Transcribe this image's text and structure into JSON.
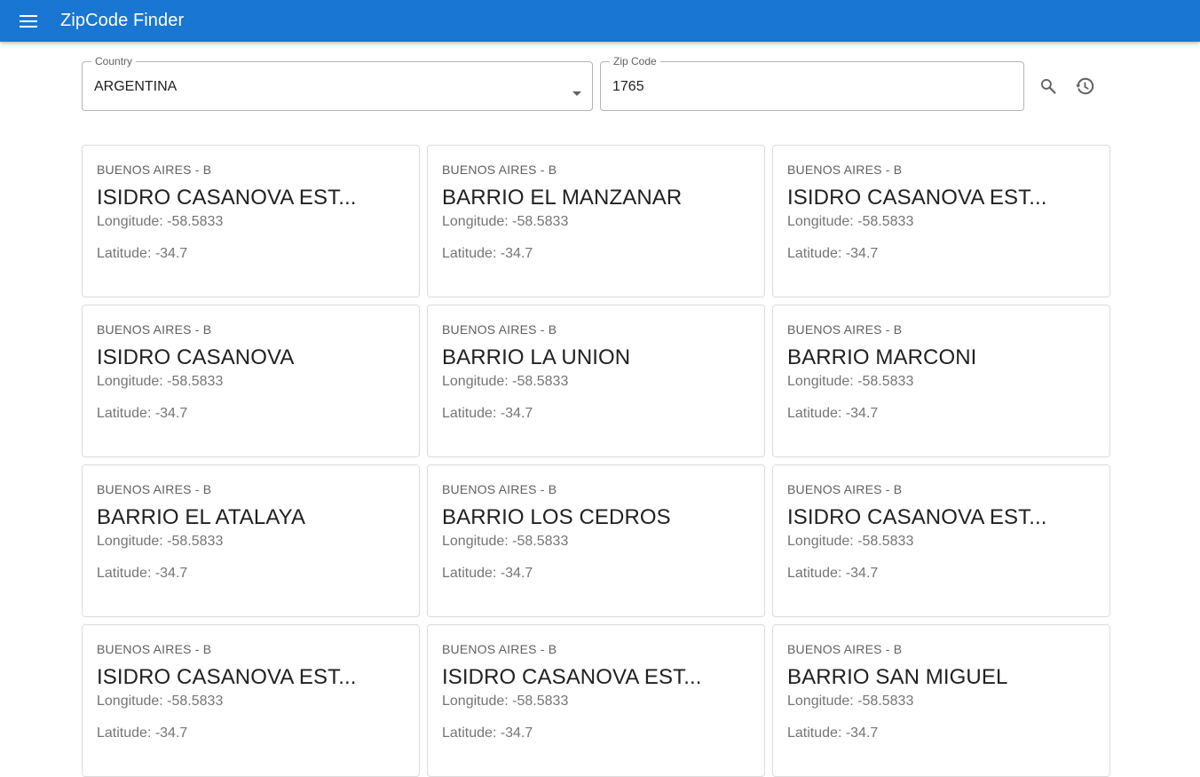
{
  "app": {
    "title": "ZipCode Finder"
  },
  "colors": {
    "appbar": "#1976d2",
    "text": "#212121",
    "muted": "#757575"
  },
  "icons": {
    "menu": "menu-icon",
    "dropdown": "arrow-drop-down-icon",
    "search": "search-icon",
    "history": "history-icon"
  },
  "search": {
    "country_label": "Country",
    "country_value": "ARGENTINA",
    "zip_label": "Zip Code",
    "zip_value": "1765"
  },
  "results": [
    {
      "region": "BUENOS AIRES - B",
      "name": "ISIDRO CASANOVA EST...",
      "longitude": "Longitude: -58.5833",
      "latitude": "Latitude: -34.7"
    },
    {
      "region": "BUENOS AIRES - B",
      "name": "BARRIO EL MANZANAR",
      "longitude": "Longitude: -58.5833",
      "latitude": "Latitude: -34.7"
    },
    {
      "region": "BUENOS AIRES - B",
      "name": "ISIDRO CASANOVA EST...",
      "longitude": "Longitude: -58.5833",
      "latitude": "Latitude: -34.7"
    },
    {
      "region": "BUENOS AIRES - B",
      "name": "ISIDRO CASANOVA",
      "longitude": "Longitude: -58.5833",
      "latitude": "Latitude: -34.7"
    },
    {
      "region": "BUENOS AIRES - B",
      "name": "BARRIO LA UNION",
      "longitude": "Longitude: -58.5833",
      "latitude": "Latitude: -34.7"
    },
    {
      "region": "BUENOS AIRES - B",
      "name": "BARRIO MARCONI",
      "longitude": "Longitude: -58.5833",
      "latitude": "Latitude: -34.7"
    },
    {
      "region": "BUENOS AIRES - B",
      "name": "BARRIO EL ATALAYA",
      "longitude": "Longitude: -58.5833",
      "latitude": "Latitude: -34.7"
    },
    {
      "region": "BUENOS AIRES - B",
      "name": "BARRIO LOS CEDROS",
      "longitude": "Longitude: -58.5833",
      "latitude": "Latitude: -34.7"
    },
    {
      "region": "BUENOS AIRES - B",
      "name": "ISIDRO CASANOVA EST...",
      "longitude": "Longitude: -58.5833",
      "latitude": "Latitude: -34.7"
    },
    {
      "region": "BUENOS AIRES - B",
      "name": "ISIDRO CASANOVA EST...",
      "longitude": "Longitude: -58.5833",
      "latitude": "Latitude: -34.7"
    },
    {
      "region": "BUENOS AIRES - B",
      "name": "ISIDRO CASANOVA EST...",
      "longitude": "Longitude: -58.5833",
      "latitude": "Latitude: -34.7"
    },
    {
      "region": "BUENOS AIRES - B",
      "name": "BARRIO SAN MIGUEL",
      "longitude": "Longitude: -58.5833",
      "latitude": "Latitude: -34.7"
    }
  ]
}
